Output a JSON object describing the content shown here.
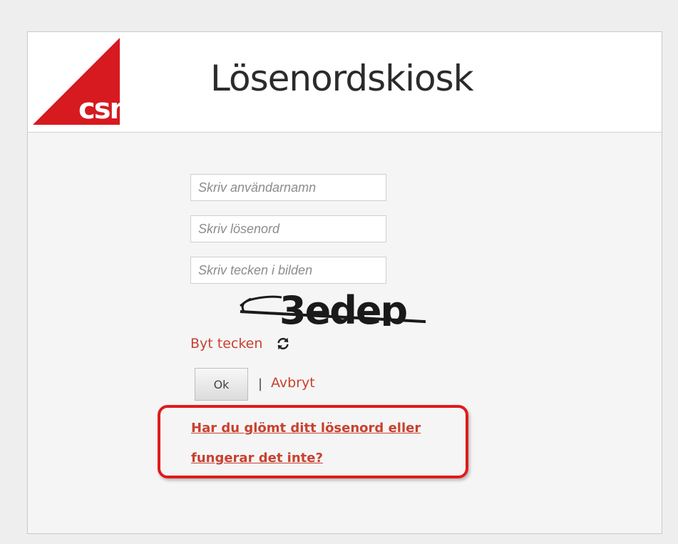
{
  "header": {
    "title": "Lösenordskiosk",
    "logo_text": "csn",
    "brand_color": "#d71920"
  },
  "form": {
    "username_placeholder": "Skriv användarnamn",
    "password_placeholder": "Skriv lösenord",
    "captcha_placeholder": "Skriv tecken i bilden",
    "captcha_text": "3edep",
    "refresh_label": "Byt tecken",
    "ok_label": "Ok",
    "separator": "|",
    "cancel_label": "Avbryt",
    "help_link": "Har du glömt ditt lösenord eller fungerar det inte?"
  },
  "colors": {
    "link": "#c8412f",
    "highlight_border": "#e01b1b"
  }
}
